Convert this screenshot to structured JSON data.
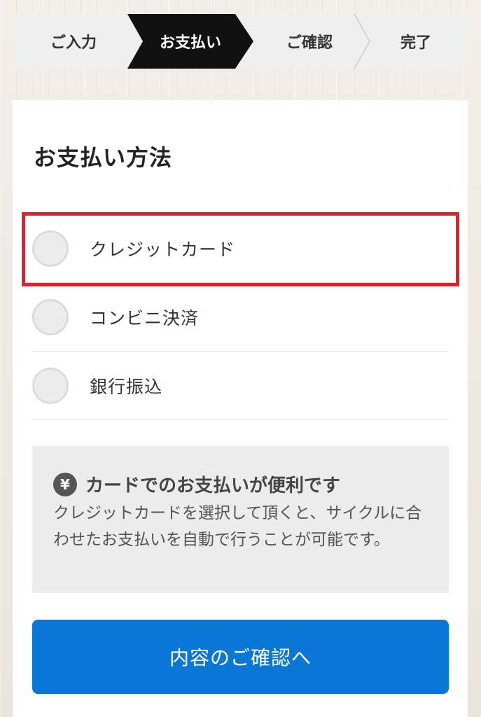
{
  "stepper": {
    "steps": [
      "ご入力",
      "お支払い",
      "ご確認",
      "完了"
    ],
    "active_index": 1
  },
  "payment": {
    "title": "お支払い方法",
    "options": [
      "クレジットカード",
      "コンビニ決済",
      "銀行振込"
    ],
    "highlighted_option": "クレジットカード"
  },
  "info": {
    "icon": "yen-icon",
    "icon_glyph": "¥",
    "heading": "カードでのお支払いが便利です",
    "body": "クレジットカードを選択して頂くと、サイクルに合わせたお支払いを自動で行うことが可能です。"
  },
  "cta": {
    "label": "内容のご確認へ"
  },
  "colors": {
    "active_step": "#111111",
    "highlight_border": "#e0202a",
    "button": "#0a76d6"
  }
}
